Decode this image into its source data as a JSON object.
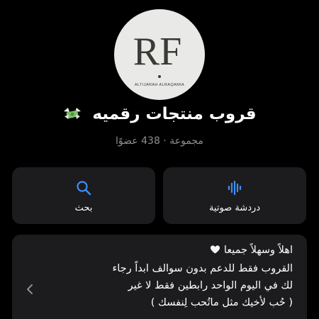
{
  "group": {
    "title": "قروب منتجات رقميه",
    "title_icon": "money-with-wings-icon",
    "subtitle": "مجموعة · 438 عضوًا",
    "avatar": {
      "letters": "RF",
      "caption": "ALTIJARAH ALRAQAMIA",
      "background": "#e9e9e7",
      "ink": "#3a3a36"
    }
  },
  "actions": {
    "search_label": "بحث",
    "search_icon": "search-icon",
    "voice_label": "دردشة صوتية",
    "voice_icon": "sound-wave-icon",
    "accent": "#3e8ef7"
  },
  "description": {
    "lines": [
      "اهلاً وسهلاً جميعا",
      "القروب فقط للدعم بدون سوالف ابداً رجاء",
      "لك في اليوم الواحد رابطين فقط لا غير",
      "( حُب لأخيك مثل ماتُحب لِنفسك )"
    ],
    "heart_icon": "white-heart-icon"
  }
}
